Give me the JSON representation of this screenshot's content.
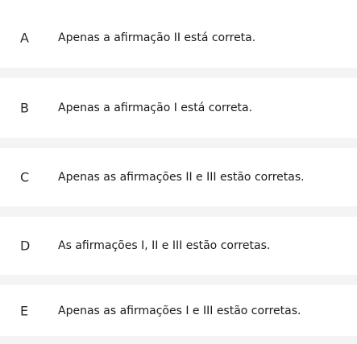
{
  "options": [
    {
      "letter": "A",
      "text": "Apenas a afirmação II está correta."
    },
    {
      "letter": "B",
      "text": "Apenas a afirmação I está correta."
    },
    {
      "letter": "C",
      "text": "Apenas as afirmações II e III estão corretas."
    },
    {
      "letter": "D",
      "text": "As afirmações I, II e III estão corretas."
    },
    {
      "letter": "E",
      "text": "Apenas as afirmações I e III estão corretas."
    }
  ]
}
